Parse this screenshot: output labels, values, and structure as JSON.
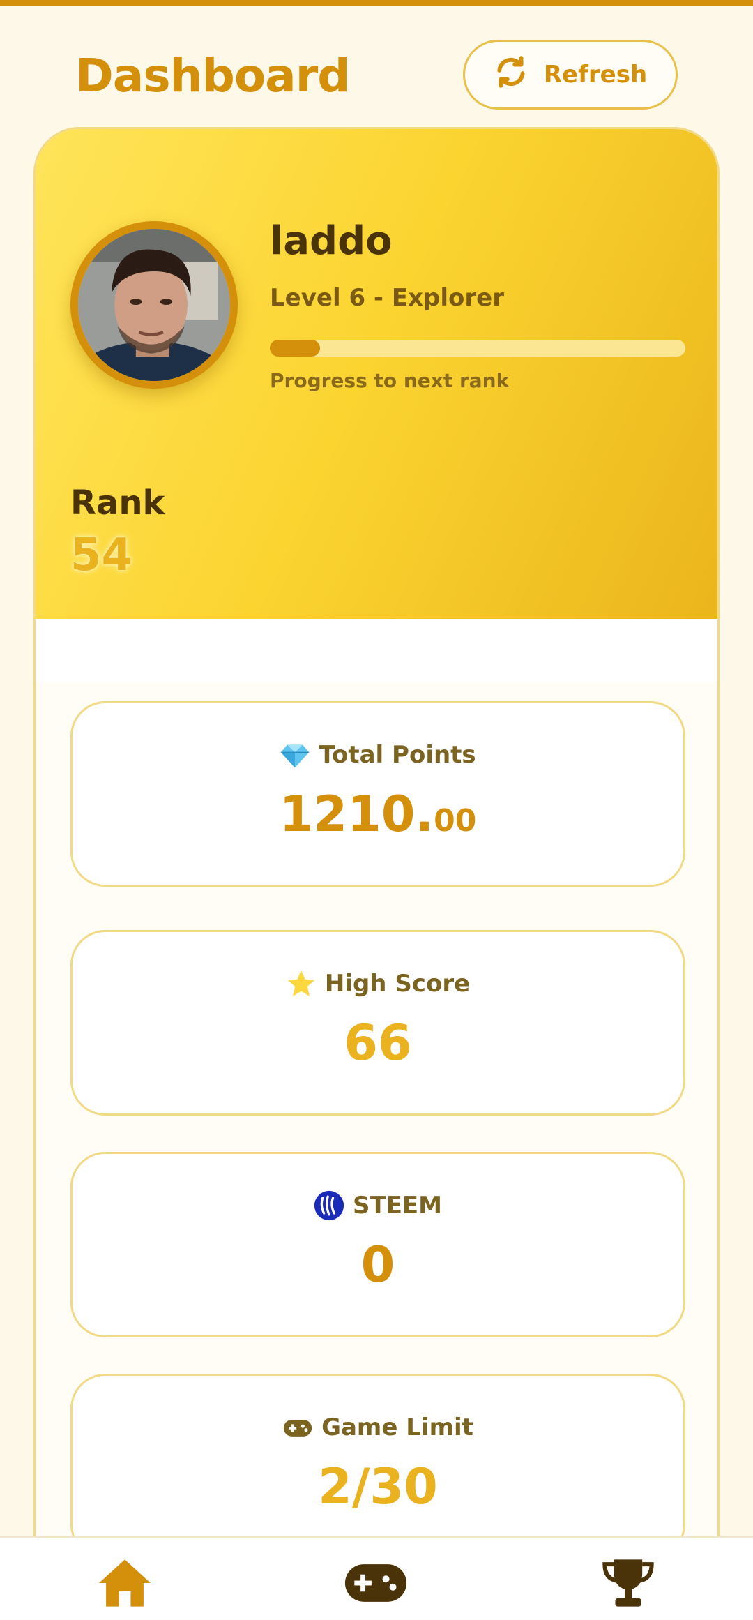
{
  "header": {
    "title": "Dashboard",
    "refresh_label": "Refresh",
    "refresh_icon": "refresh-icon"
  },
  "profile": {
    "username": "laddo",
    "level": "Level 6 - Explorer",
    "progress_fraction": 0.12,
    "progress_label": "Progress to next rank",
    "rank_label": "Rank",
    "rank_value": "54"
  },
  "stats": [
    {
      "icon": "diamond-icon",
      "label": "Total Points",
      "value_int": "1210.",
      "value_dec": "00"
    },
    {
      "icon": "star-icon",
      "label": "High Score",
      "value": "66"
    },
    {
      "icon": "steem-icon",
      "label": "STEEM",
      "value": "0"
    },
    {
      "icon": "gamepad-icon",
      "label": "Game Limit",
      "value": "2/30"
    }
  ],
  "bottom_nav": [
    "home-icon",
    "gamepad-icon",
    "trophy-icon"
  ],
  "colors": {
    "accent": "#d4900a",
    "accent_light": "#eab21e",
    "background": "#fdf8e8",
    "hero_gradient_start": "#ffe45a",
    "hero_gradient_end": "#eab51c"
  }
}
